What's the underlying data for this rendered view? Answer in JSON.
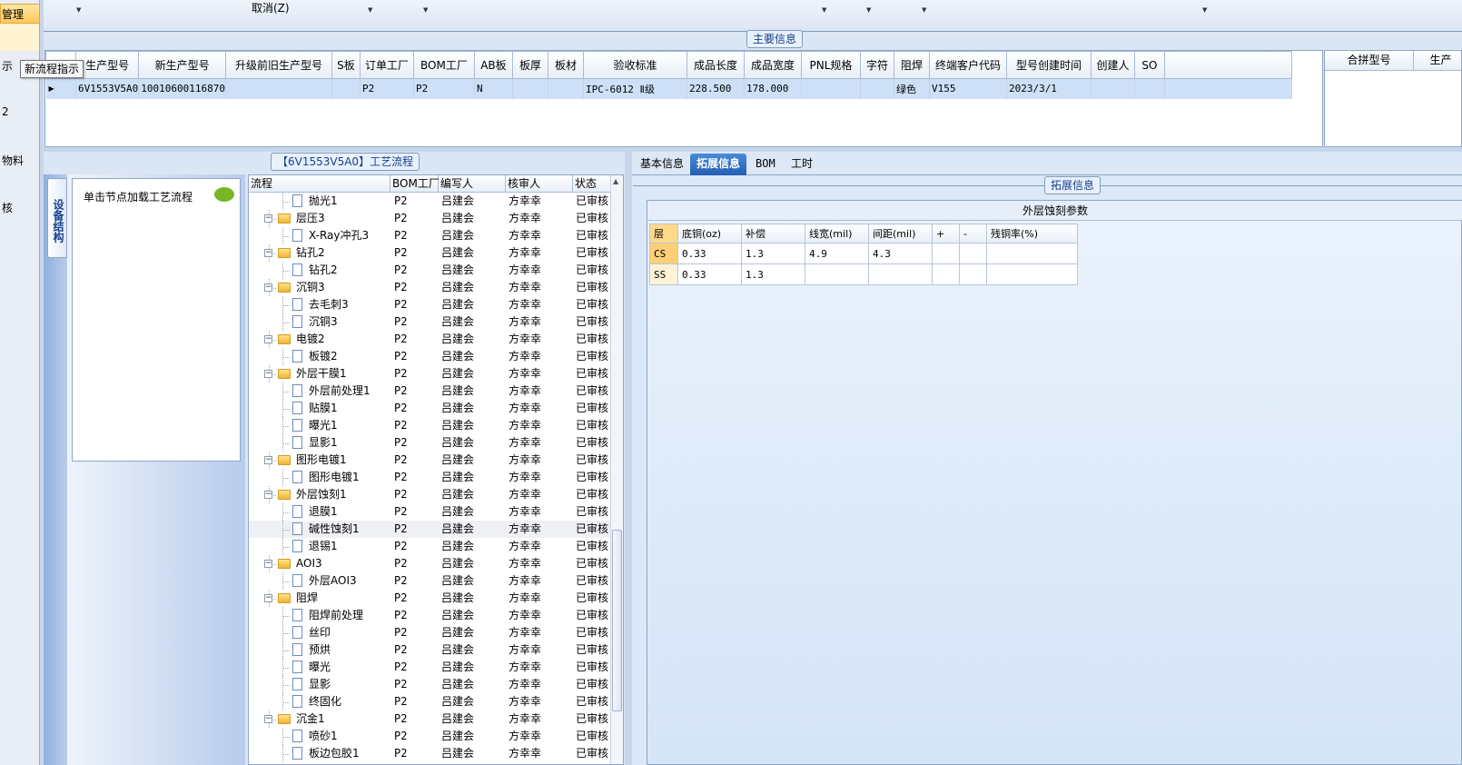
{
  "left_nav": {
    "items": [
      "管理",
      "示",
      "2",
      "物料",
      "核"
    ]
  },
  "toolbar": {
    "cancel_label": "取消(Z)"
  },
  "main_info": {
    "title": "主要信息",
    "columns": [
      "生产型号",
      "新生产型号",
      "升级前旧生产型号",
      "S板",
      "订单工厂",
      "BOM工厂",
      "AB板",
      "板厚",
      "板材",
      "验收标准",
      "成品长度",
      "成品宽度",
      "PNL规格",
      "字符",
      "阻焊",
      "终端客户代码",
      "型号创建时间",
      "创建人",
      "SO"
    ],
    "rows": [
      [
        "6V1553V5A0",
        "10010600116870",
        "",
        "",
        "P2",
        "P2",
        "N",
        "",
        "",
        "IPC-6012 Ⅱ级",
        "228.500",
        "178.000",
        "",
        "",
        "绿色",
        "V155",
        "2023/3/1",
        "",
        ""
      ]
    ],
    "side_columns": [
      "合拼型号",
      "生产"
    ]
  },
  "tooltip": "新流程指示",
  "process_panel": {
    "title": "【6V1553V5A0】工艺流程",
    "vertical_tab": "设备结构",
    "nav_hint": "单击节点加载工艺流程",
    "columns": [
      "流程",
      "BOM工厂",
      "编写人",
      "核审人",
      "状态"
    ],
    "rows": [
      {
        "name": "抛光1",
        "type": "doc",
        "bom": "P2",
        "writer": "吕建会",
        "reviewer": "方幸幸",
        "status": "已审核"
      },
      {
        "name": "层压3",
        "type": "folder",
        "bom": "P2",
        "writer": "吕建会",
        "reviewer": "方幸幸",
        "status": "已审核"
      },
      {
        "name": "X-Ray冲孔3",
        "type": "doc",
        "bom": "P2",
        "writer": "吕建会",
        "reviewer": "方幸幸",
        "status": "已审核"
      },
      {
        "name": "钻孔2",
        "type": "folder",
        "bom": "P2",
        "writer": "吕建会",
        "reviewer": "方幸幸",
        "status": "已审核"
      },
      {
        "name": "钻孔2",
        "type": "doc",
        "bom": "P2",
        "writer": "吕建会",
        "reviewer": "方幸幸",
        "status": "已审核"
      },
      {
        "name": "沉铜3",
        "type": "folder",
        "bom": "P2",
        "writer": "吕建会",
        "reviewer": "方幸幸",
        "status": "已审核"
      },
      {
        "name": "去毛刺3",
        "type": "doc",
        "bom": "P2",
        "writer": "吕建会",
        "reviewer": "方幸幸",
        "status": "已审核"
      },
      {
        "name": "沉铜3",
        "type": "doc",
        "bom": "P2",
        "writer": "吕建会",
        "reviewer": "方幸幸",
        "status": "已审核"
      },
      {
        "name": "电镀2",
        "type": "folder",
        "bom": "P2",
        "writer": "吕建会",
        "reviewer": "方幸幸",
        "status": "已审核"
      },
      {
        "name": "板镀2",
        "type": "doc",
        "bom": "P2",
        "writer": "吕建会",
        "reviewer": "方幸幸",
        "status": "已审核"
      },
      {
        "name": "外层干膜1",
        "type": "folder",
        "bom": "P2",
        "writer": "吕建会",
        "reviewer": "方幸幸",
        "status": "已审核"
      },
      {
        "name": "外层前处理1",
        "type": "doc",
        "bom": "P2",
        "writer": "吕建会",
        "reviewer": "方幸幸",
        "status": "已审核"
      },
      {
        "name": "贴膜1",
        "type": "doc",
        "bom": "P2",
        "writer": "吕建会",
        "reviewer": "方幸幸",
        "status": "已审核"
      },
      {
        "name": "曝光1",
        "type": "doc",
        "bom": "P2",
        "writer": "吕建会",
        "reviewer": "方幸幸",
        "status": "已审核"
      },
      {
        "name": "显影1",
        "type": "doc",
        "bom": "P2",
        "writer": "吕建会",
        "reviewer": "方幸幸",
        "status": "已审核"
      },
      {
        "name": "图形电镀1",
        "type": "folder",
        "bom": "P2",
        "writer": "吕建会",
        "reviewer": "方幸幸",
        "status": "已审核"
      },
      {
        "name": "图形电镀1",
        "type": "doc",
        "bom": "P2",
        "writer": "吕建会",
        "reviewer": "方幸幸",
        "status": "已审核"
      },
      {
        "name": "外层蚀刻1",
        "type": "folder",
        "bom": "P2",
        "writer": "吕建会",
        "reviewer": "方幸幸",
        "status": "已审核"
      },
      {
        "name": "退膜1",
        "type": "doc",
        "bom": "P2",
        "writer": "吕建会",
        "reviewer": "方幸幸",
        "status": "已审核"
      },
      {
        "name": "碱性蚀刻1",
        "type": "doc",
        "bom": "P2",
        "writer": "吕建会",
        "reviewer": "方幸幸",
        "status": "已审核",
        "highlight": true
      },
      {
        "name": "退锡1",
        "type": "doc",
        "bom": "P2",
        "writer": "吕建会",
        "reviewer": "方幸幸",
        "status": "已审核"
      },
      {
        "name": "AOI3",
        "type": "folder",
        "bom": "P2",
        "writer": "吕建会",
        "reviewer": "方幸幸",
        "status": "已审核"
      },
      {
        "name": "外层AOI3",
        "type": "doc",
        "bom": "P2",
        "writer": "吕建会",
        "reviewer": "方幸幸",
        "status": "已审核"
      },
      {
        "name": "阻焊",
        "type": "folder",
        "bom": "P2",
        "writer": "吕建会",
        "reviewer": "方幸幸",
        "status": "已审核"
      },
      {
        "name": "阻焊前处理",
        "type": "doc",
        "bom": "P2",
        "writer": "吕建会",
        "reviewer": "方幸幸",
        "status": "已审核"
      },
      {
        "name": "丝印",
        "type": "doc",
        "bom": "P2",
        "writer": "吕建会",
        "reviewer": "方幸幸",
        "status": "已审核"
      },
      {
        "name": "预烘",
        "type": "doc",
        "bom": "P2",
        "writer": "吕建会",
        "reviewer": "方幸幸",
        "status": "已审核"
      },
      {
        "name": "曝光",
        "type": "doc",
        "bom": "P2",
        "writer": "吕建会",
        "reviewer": "方幸幸",
        "status": "已审核"
      },
      {
        "name": "显影",
        "type": "doc",
        "bom": "P2",
        "writer": "吕建会",
        "reviewer": "方幸幸",
        "status": "已审核"
      },
      {
        "name": "终固化",
        "type": "doc",
        "bom": "P2",
        "writer": "吕建会",
        "reviewer": "方幸幸",
        "status": "已审核"
      },
      {
        "name": "沉金1",
        "type": "folder",
        "bom": "P2",
        "writer": "吕建会",
        "reviewer": "方幸幸",
        "status": "已审核"
      },
      {
        "name": "喷砂1",
        "type": "doc",
        "bom": "P2",
        "writer": "吕建会",
        "reviewer": "方幸幸",
        "status": "已审核"
      },
      {
        "name": "板边包胶1",
        "type": "doc",
        "bom": "P2",
        "writer": "吕建会",
        "reviewer": "方幸幸",
        "status": "已审核"
      }
    ]
  },
  "right_panel": {
    "tabs": [
      {
        "label": "基本信息",
        "active": false
      },
      {
        "label": "拓展信息",
        "active": true
      },
      {
        "label": "BOM",
        "active": false
      },
      {
        "label": "工时",
        "active": false
      }
    ],
    "section_title": "拓展信息",
    "params_title": "外层蚀刻参数",
    "columns": [
      "层",
      "底铜(oz)",
      "补偿",
      "线宽(mil)",
      "间距(mil)",
      "+",
      "-",
      "残铜率(%)"
    ],
    "rows": [
      [
        "CS",
        "0.33",
        "1.3",
        "4.9",
        "4.3",
        "",
        "",
        ""
      ],
      [
        "SS",
        "0.33",
        "1.3",
        "",
        "",
        "",
        "",
        ""
      ]
    ]
  }
}
